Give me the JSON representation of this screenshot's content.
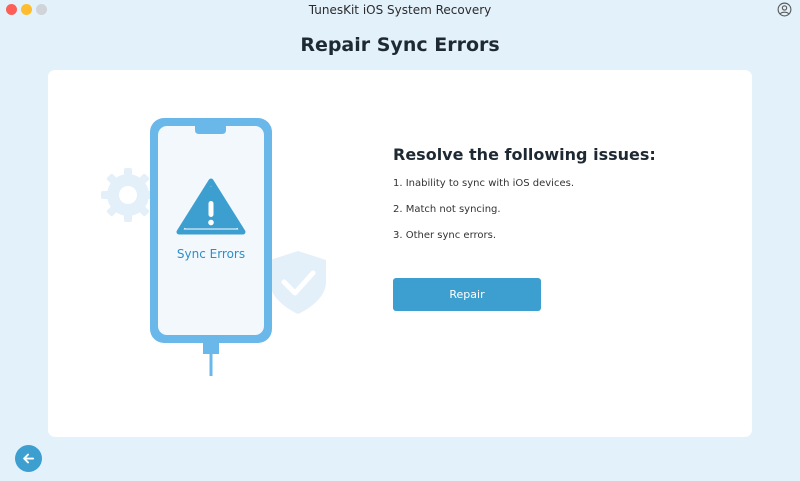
{
  "window": {
    "title": "TunesKit iOS System Recovery"
  },
  "page": {
    "title": "Repair Sync Errors"
  },
  "illustration": {
    "phone_label": "Sync Errors",
    "icons": [
      "gear-icon",
      "shield-check-icon",
      "warning-triangle-icon"
    ]
  },
  "issues": {
    "heading": "Resolve the following issues:",
    "items": [
      "1. Inability to sync with iOS devices.",
      "2. Match not syncing.",
      "3. Other sync errors."
    ]
  },
  "actions": {
    "repair_label": "Repair",
    "back_icon": "back-arrow-icon"
  },
  "colors": {
    "accent": "#3d9fd0",
    "phone_frame": "#6ab8ea",
    "background": "#e3f1fb",
    "card": "#ffffff"
  }
}
